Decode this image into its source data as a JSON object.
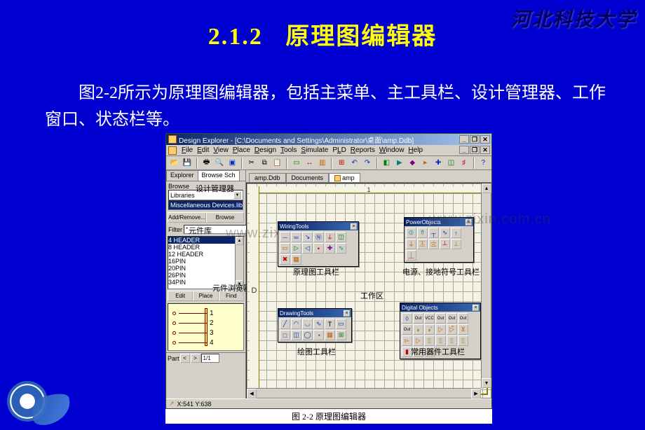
{
  "slide": {
    "university": "河北科技大学",
    "section_number": "2.1.2",
    "section_title": "原理图编辑器",
    "body": "图2-2所示为原理图编辑器，包括主菜单、主工具栏、设计管理器、工作窗口、状态栏等。",
    "caption": "图 2-2  原理图编辑器"
  },
  "watermark": "www.zixin.com.cn",
  "window": {
    "title": "Design Explorer - [C:\\Documents and Settings\\Administrator\\桌面\\amp.Ddb]",
    "min": "_",
    "max": "❐",
    "close": "✕"
  },
  "menu": {
    "items": [
      "File",
      "Edit",
      "View",
      "Place",
      "Design",
      "Tools",
      "Simulate",
      "PLD",
      "Reports",
      "Window",
      "Help"
    ]
  },
  "doc_tabs": {
    "t1": "amp.Ddb",
    "t2": "Documents",
    "t3": "amp"
  },
  "left_panel": {
    "tab_explorer": "Explorer",
    "tab_browse": "Browse Sch",
    "annot_mgr": "设计管理器",
    "browse_label": "Browse",
    "dropdown": "Libraries",
    "highlight": "Miscellaneous Devices.lib",
    "annot_lib": "元件库",
    "btn_add": "Add/Remove...",
    "btn_browse": "Browse",
    "filter_label": "Filter",
    "filter_value": "*",
    "list": [
      "4 HEADER",
      "8 HEADER",
      "12 HEADER",
      "16PIN",
      "20PIN",
      "26PIN",
      "34PIN"
    ],
    "annot_browser": "元件浏览器",
    "btn_edit": "Edit",
    "btn_place": "Place",
    "btn_find": "Find",
    "pins": [
      "1",
      "2",
      "3",
      "4"
    ],
    "nav_part": "Part",
    "nav_page": "1/1"
  },
  "canvas": {
    "ruler_top": "1",
    "ruler_left": "D",
    "work_area": "工作区",
    "status": "X:541 Y:638"
  },
  "palettes": {
    "wiring": {
      "title": "WiringTools",
      "annot": "原理图工具栏"
    },
    "power": {
      "title": "PowerObjects",
      "annot": "电源、接地符号工具栏"
    },
    "drawing": {
      "title": "DrawingTools",
      "annot": "绘图工具栏"
    },
    "digital": {
      "title": "Digital Objects",
      "annot": "常用器件工具栏"
    }
  }
}
